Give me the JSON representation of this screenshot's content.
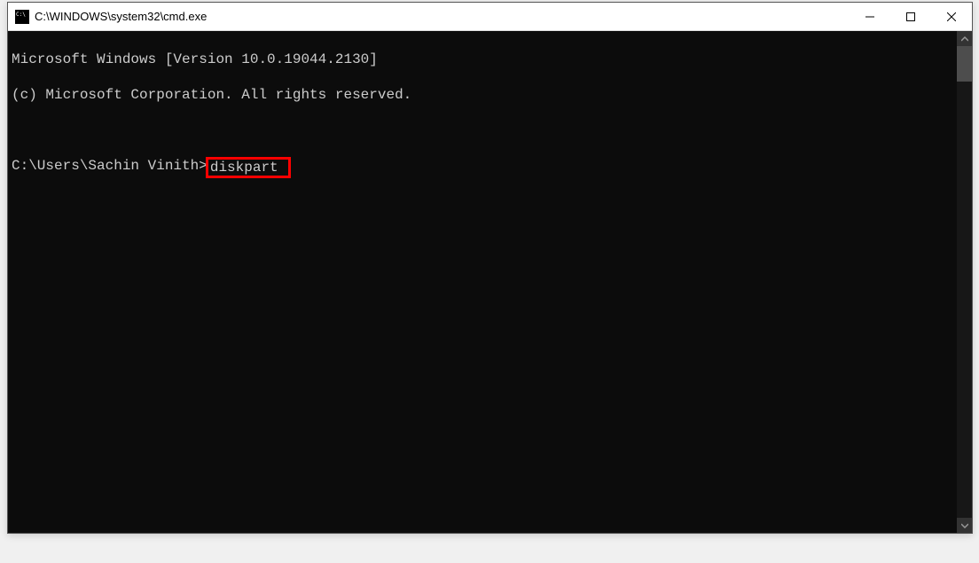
{
  "window": {
    "title": "C:\\WINDOWS\\system32\\cmd.exe"
  },
  "console": {
    "line1": "Microsoft Windows [Version 10.0.19044.2130]",
    "line2": "(c) Microsoft Corporation. All rights reserved.",
    "prompt": "C:\\Users\\Sachin Vinith>",
    "command": "diskpart"
  },
  "icons": {
    "minimize": "minimize",
    "maximize": "maximize",
    "close": "close"
  }
}
